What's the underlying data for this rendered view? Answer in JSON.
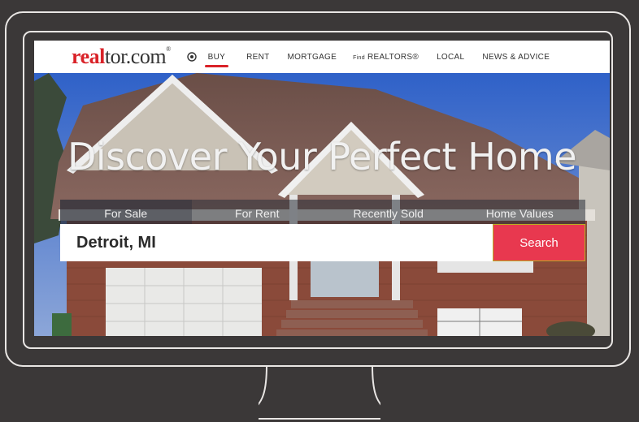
{
  "brand": {
    "logo_part1": "real",
    "logo_part2": "tor.com",
    "logo_mark": "®"
  },
  "nav": {
    "items": [
      {
        "label": "BUY",
        "active": true
      },
      {
        "label": "RENT"
      },
      {
        "label": "MORTGAGE"
      },
      {
        "label_prefix": "Find",
        "label": "REALTORS®"
      },
      {
        "label": "LOCAL"
      },
      {
        "label": "NEWS & ADVICE"
      }
    ]
  },
  "hero": {
    "title": "Discover Your Perfect Home",
    "tabs": [
      {
        "label": "For Sale",
        "active": true
      },
      {
        "label": "For Rent"
      },
      {
        "label": "Recently Sold"
      },
      {
        "label": "Home Values"
      }
    ]
  },
  "search": {
    "value": "Detroit, MI",
    "button_label": "Search"
  },
  "colors": {
    "brand_red": "#d92228",
    "search_button": "#e8384f",
    "paper": "#3b3838"
  },
  "icons": [
    "location-target-icon",
    "search-icon"
  ]
}
